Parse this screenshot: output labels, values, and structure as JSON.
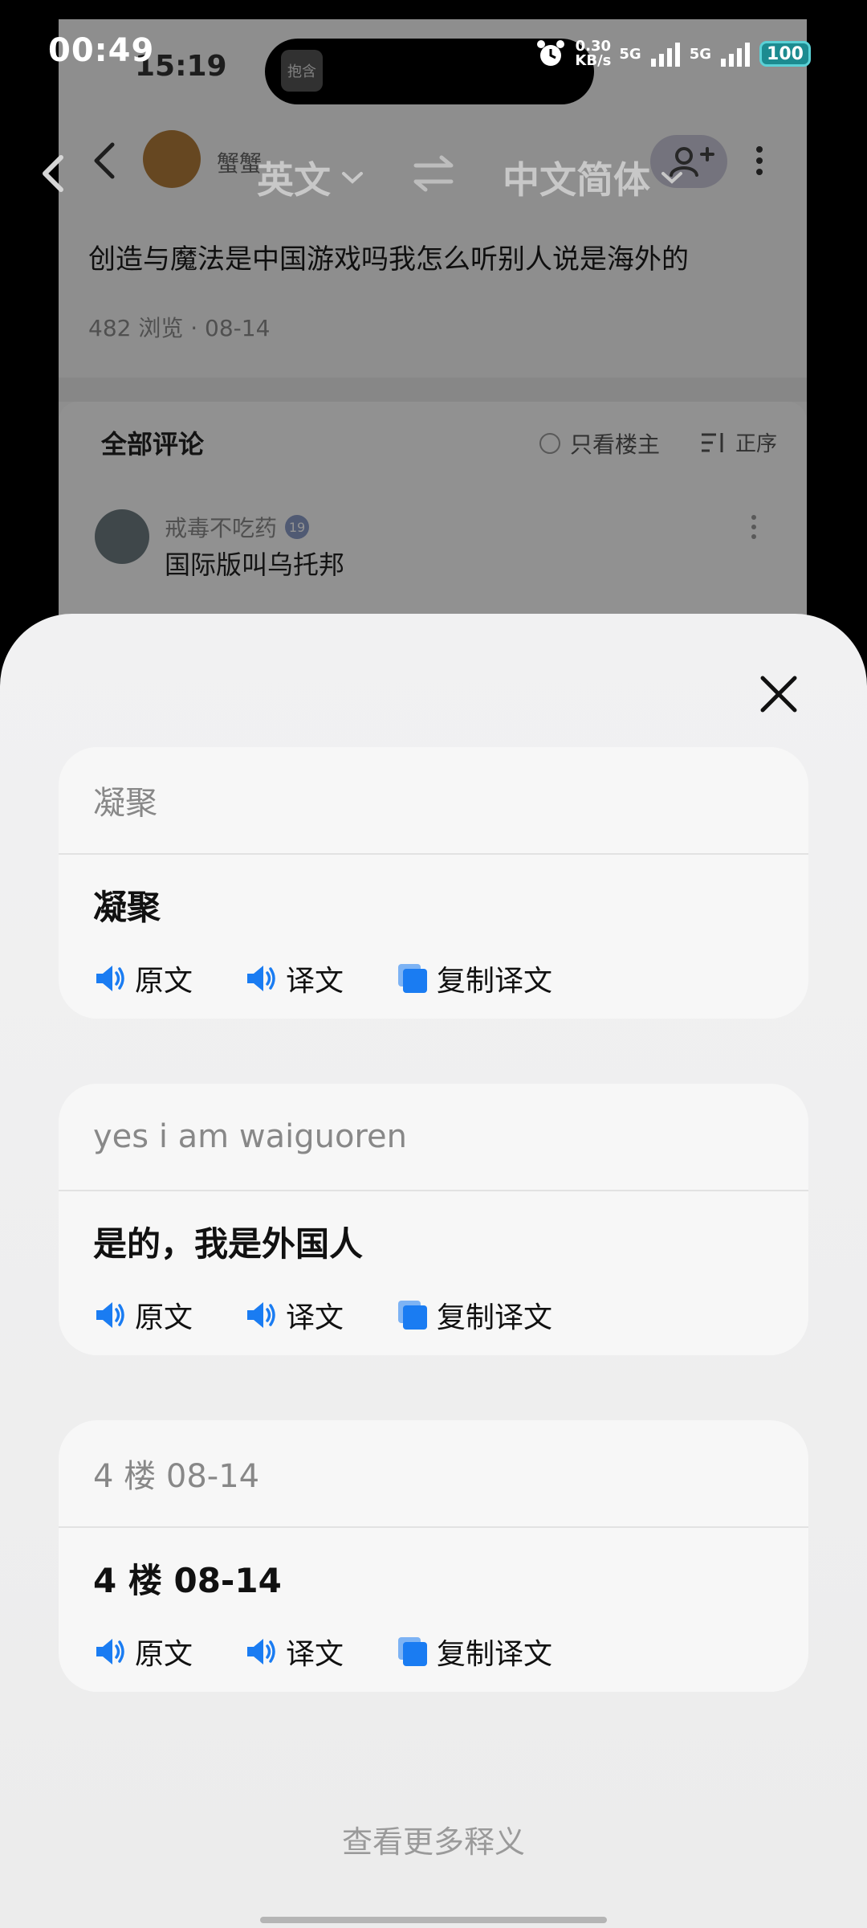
{
  "status_bar": {
    "time": "00:49",
    "net_speed_value": "0.30",
    "net_speed_unit": "KB/s",
    "sim1": "5G",
    "sim2": "5G",
    "battery": "100"
  },
  "background_app": {
    "status_time": "15:19",
    "island_app_label": "抱含",
    "username": "蟹蟹",
    "post_title": "创造与魔法是中国游戏吗我怎么听别人说是海外的",
    "post_meta": "482 浏览 · 08-14",
    "comments_title": "全部评论",
    "only_author": "只看楼主",
    "sort": "正序",
    "comment_user": "戒毒不吃药",
    "comment_level": "19",
    "comment_text": "国际版叫乌托邦"
  },
  "translate_bar": {
    "source_lang": "英文",
    "target_lang": "中文简体"
  },
  "translations": [
    {
      "source": "凝聚",
      "target": "凝聚",
      "actions": {
        "play_source": "原文",
        "play_target": "译文",
        "copy": "复制译文"
      }
    },
    {
      "source": "yes i am waiguoren",
      "target": "是的，我是外国人",
      "actions": {
        "play_source": "原文",
        "play_target": "译文",
        "copy": "复制译文"
      }
    },
    {
      "source": "4 楼 08-14",
      "target": "4 楼 08-14",
      "actions": {
        "play_source": "原文",
        "play_target": "译文",
        "copy": "复制译文"
      }
    }
  ],
  "more_meanings": "查看更多释义",
  "colors": {
    "accent": "#1a7cf2",
    "sheet_bg": "#f1f1f2",
    "card_bg": "#f7f7f7",
    "battery": "#5ad1d6"
  }
}
